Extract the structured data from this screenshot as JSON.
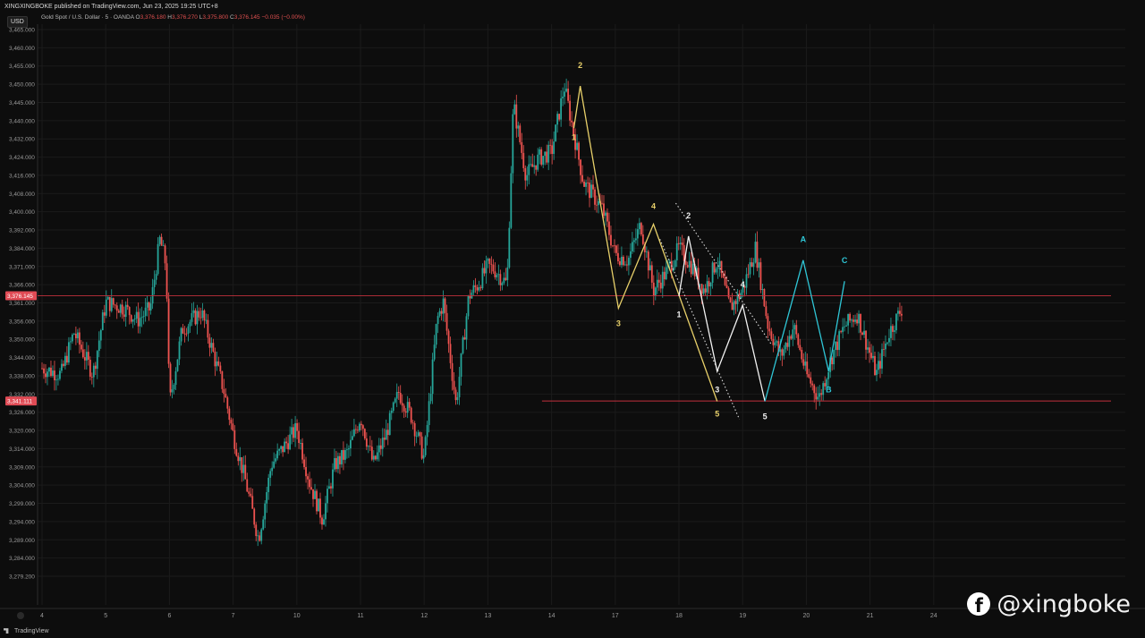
{
  "header": {
    "publisher_line": "XINGXINGBOKE published on TradingView.com, Jun 23, 2025 19:25 UTC+8",
    "symbol_line": "Gold Spot / U.S. Dollar · 5 · OANDA",
    "ohlc": [
      {
        "key": "O",
        "value": "3,376.180"
      },
      {
        "key": "H",
        "value": "3,376.270"
      },
      {
        "key": "L",
        "value": "3,375.800"
      },
      {
        "key": "C",
        "value": "3,376.145 −0.035 (−0.00%)"
      }
    ],
    "currency": "USD"
  },
  "footer": {
    "brand": "TradingView"
  },
  "watermark": {
    "glyph": "f",
    "text": "@xingboke",
    "icon": "facebook-icon"
  },
  "colors": {
    "background": "#0d0d0d",
    "grid": "#1b1b1b",
    "candle_up": "#26a69a",
    "candle_down": "#ef5350",
    "price_line": "#c2303c",
    "support_line": "#c2303c",
    "wave_yellow": "#e8d06a",
    "wave_white": "#f2f2f2",
    "wave_teal": "#2fc6d6",
    "channel": "#dddddd",
    "axis_text": "#9a9a9a",
    "price_tag_bg": "#e04b55"
  },
  "chart_data": {
    "type": "candlestick",
    "symbol": "Gold Spot / U.S. Dollar",
    "timeframe": "5",
    "exchange": "OANDA",
    "y_range": [
      3275,
      3466
    ],
    "y_tick_labels": [
      "3,465.000",
      "3,460.000",
      "3,455.000",
      "3,450.000",
      "3,445.000",
      "3,440.000",
      "3,432.000",
      "3,424.000",
      "3,416.000",
      "3,408.000",
      "3,400.000",
      "3,392.000",
      "3,384.000",
      "3,371.000",
      "3,366.000",
      "3,361.000",
      "3,356.000",
      "3,350.000",
      "3,344.000",
      "3,338.000",
      "3,332.000",
      "3,326.000",
      "3,320.000",
      "3,314.000",
      "3,309.000",
      "3,304.000",
      "3,299.000",
      "3,294.000",
      "3,289.000",
      "3,284.000",
      "3,279.200"
    ],
    "x_tick_labels": [
      "4",
      "5",
      "6",
      "7",
      "10",
      "11",
      "12",
      "13",
      "14",
      "17",
      "18",
      "19",
      "20",
      "21",
      "24"
    ],
    "x_tick_session_index": [
      0,
      1,
      2,
      3,
      4,
      5,
      6,
      7,
      8,
      9,
      10,
      11,
      12,
      13,
      14
    ],
    "session_count": 17.6,
    "price_profile": [
      [
        0.0,
        3352
      ],
      [
        0.3,
        3350
      ],
      [
        0.5,
        3364
      ],
      [
        0.8,
        3350
      ],
      [
        1.0,
        3374
      ],
      [
        1.3,
        3372
      ],
      [
        1.5,
        3368
      ],
      [
        1.7,
        3372
      ],
      [
        1.85,
        3395
      ],
      [
        1.95,
        3386
      ],
      [
        2.0,
        3340
      ],
      [
        2.2,
        3365
      ],
      [
        2.5,
        3371
      ],
      [
        2.7,
        3356
      ],
      [
        2.85,
        3345
      ],
      [
        3.0,
        3330
      ],
      [
        3.2,
        3314
      ],
      [
        3.4,
        3295
      ],
      [
        3.6,
        3320
      ],
      [
        3.8,
        3326
      ],
      [
        4.0,
        3332
      ],
      [
        4.2,
        3314
      ],
      [
        4.4,
        3302
      ],
      [
        4.6,
        3320
      ],
      [
        4.8,
        3324
      ],
      [
        5.0,
        3336
      ],
      [
        5.2,
        3320
      ],
      [
        5.4,
        3330
      ],
      [
        5.6,
        3344
      ],
      [
        5.8,
        3336
      ],
      [
        6.0,
        3322
      ],
      [
        6.2,
        3368
      ],
      [
        6.3,
        3374
      ],
      [
        6.5,
        3340
      ],
      [
        6.7,
        3376
      ],
      [
        6.85,
        3380
      ],
      [
        7.0,
        3386
      ],
      [
        7.1,
        3385
      ],
      [
        7.3,
        3380
      ],
      [
        7.4,
        3440
      ],
      [
        7.6,
        3416
      ],
      [
        7.8,
        3422
      ],
      [
        8.0,
        3424
      ],
      [
        8.2,
        3446
      ],
      [
        8.5,
        3414
      ],
      [
        8.8,
        3405
      ],
      [
        9.0,
        3390
      ],
      [
        9.2,
        3388
      ],
      [
        9.4,
        3400
      ],
      [
        9.6,
        3378
      ],
      [
        9.8,
        3384
      ],
      [
        10.0,
        3392
      ],
      [
        10.2,
        3386
      ],
      [
        10.4,
        3378
      ],
      [
        10.6,
        3388
      ],
      [
        10.8,
        3372
      ],
      [
        11.0,
        3378
      ],
      [
        11.2,
        3392
      ],
      [
        11.4,
        3366
      ],
      [
        11.6,
        3356
      ],
      [
        11.8,
        3366
      ],
      [
        12.0,
        3350
      ],
      [
        12.2,
        3342
      ],
      [
        12.4,
        3356
      ],
      [
        12.6,
        3366
      ],
      [
        12.8,
        3370
      ],
      [
        13.1,
        3350
      ],
      [
        13.3,
        3364
      ],
      [
        13.5,
        3372
      ]
    ],
    "last_price": 3376.145,
    "last_price_label": "3,376.145",
    "support_level": 3341.111,
    "support_label": "3,341.111",
    "waves": [
      {
        "name": "yellow",
        "points": [
          [
            8.35,
            3432
          ],
          [
            8.45,
            3446
          ],
          [
            9.05,
            3372
          ],
          [
            9.6,
            3400
          ],
          [
            10.6,
            3341
          ]
        ]
      },
      {
        "name": "white",
        "points": [
          [
            10.0,
            3376
          ],
          [
            10.15,
            3396
          ],
          [
            10.6,
            3351
          ],
          [
            11.0,
            3373
          ],
          [
            11.35,
            3341
          ]
        ]
      },
      {
        "name": "teal",
        "points": [
          [
            11.35,
            3341
          ],
          [
            11.95,
            3388
          ],
          [
            12.35,
            3351
          ],
          [
            12.6,
            3381
          ]
        ]
      }
    ],
    "wave_labels": [
      {
        "text": "2",
        "color": "yellow",
        "x": 8.45,
        "y": 3452
      },
      {
        "text": "1",
        "color": "yellow",
        "x": 8.35,
        "y": 3428
      },
      {
        "text": "3",
        "color": "yellow",
        "x": 9.05,
        "y": 3366
      },
      {
        "text": "4",
        "color": "yellow",
        "x": 9.6,
        "y": 3405
      },
      {
        "text": "5",
        "color": "yellow",
        "x": 10.6,
        "y": 3336
      },
      {
        "text": "2",
        "color": "white",
        "x": 10.15,
        "y": 3402
      },
      {
        "text": "1",
        "color": "white",
        "x": 10.0,
        "y": 3369
      },
      {
        "text": "3",
        "color": "white",
        "x": 10.6,
        "y": 3344
      },
      {
        "text": "4",
        "color": "white",
        "x": 11.0,
        "y": 3379
      },
      {
        "text": "5",
        "color": "white",
        "x": 11.35,
        "y": 3335
      },
      {
        "text": "A",
        "color": "teal",
        "x": 11.95,
        "y": 3394
      },
      {
        "text": "B",
        "color": "teal",
        "x": 12.35,
        "y": 3344
      },
      {
        "text": "C",
        "color": "teal",
        "x": 12.6,
        "y": 3387
      }
    ],
    "channel_lines": [
      [
        [
          9.95,
          3407
        ],
        [
          11.45,
          3360
        ]
      ],
      [
        [
          9.7,
          3395
        ],
        [
          10.95,
          3335
        ]
      ]
    ]
  }
}
